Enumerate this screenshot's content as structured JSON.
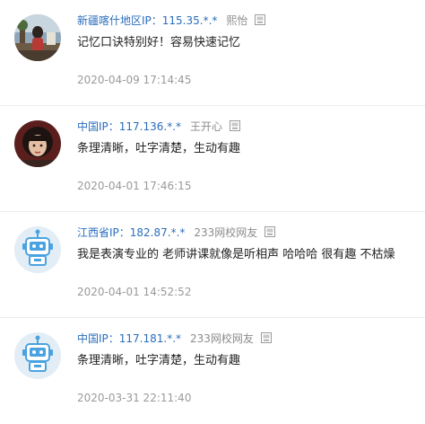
{
  "comments": [
    {
      "location": "新疆喀什地区IP：115.35.*.*",
      "username": "熙怡",
      "content": "记忆口诀特别好！容易快速记忆",
      "time": "2020-04-09 17:14:45",
      "avatar": "photo-avatar-outdoor",
      "device_icon": "computer-icon"
    },
    {
      "location": "中国IP：117.136.*.*",
      "username": "王开心",
      "content": "条理清晰，吐字清楚，生动有趣",
      "time": "2020-04-01 17:46:15",
      "avatar": "photo-avatar-girl",
      "device_icon": "computer-icon"
    },
    {
      "location": "江西省IP：182.87.*.*",
      "username": "233网校网友",
      "content": "我是表演专业的 老师讲课就像是听相声 哈哈哈 很有趣 不枯燥",
      "time": "2020-04-01 14:52:52",
      "avatar": "robot-avatar",
      "device_icon": "computer-icon"
    },
    {
      "location": "中国IP：117.181.*.*",
      "username": "233网校网友",
      "content": "条理清晰，吐字清楚，生动有趣",
      "time": "2020-03-31 22:11:40",
      "avatar": "robot-avatar",
      "device_icon": "computer-icon"
    }
  ],
  "colors": {
    "location": "#2a6ebd",
    "username": "#8c8c8c",
    "time": "#9a9a9a",
    "robot_blue": "#4aa3e0"
  }
}
